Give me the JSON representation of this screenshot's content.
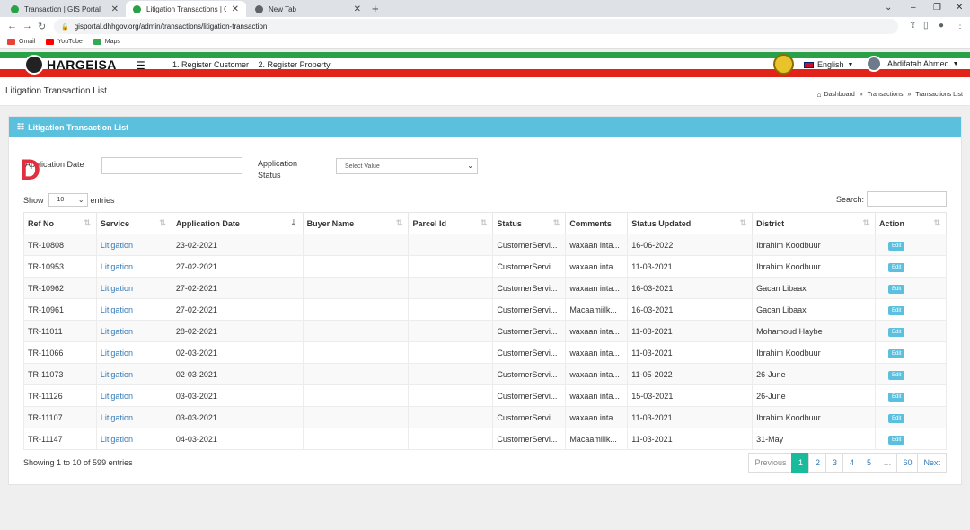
{
  "browser": {
    "tabs": [
      {
        "title": "Transaction | GIS Portal",
        "favicon_color": "#2aa147"
      },
      {
        "title": "Litigation Transactions | GIS Portal",
        "favicon_color": "#2aa147"
      },
      {
        "title": "New Tab",
        "favicon_color": "#5f6368"
      }
    ],
    "url": "gisportal.dhhgov.org/admin/transactions/litigation-transaction",
    "bookmarks": [
      {
        "label": "Gmail",
        "color": "#ea4335"
      },
      {
        "label": "YouTube",
        "color": "#ff0000"
      },
      {
        "label": "Maps",
        "color": "#34a853"
      }
    ]
  },
  "app": {
    "logo_text": "HARGEISA",
    "menu": [
      "1. Register Customer",
      "2. Register Property"
    ],
    "language": "English",
    "user_name": "Abdifatah Ahmed"
  },
  "page": {
    "title": "Litigation Transaction List",
    "breadcrumb": [
      "Dashboard",
      "Transactions",
      "Transactions List"
    ]
  },
  "card": {
    "title": "Litigation Transaction List",
    "filter_date_label": "Application Date",
    "filter_status_label_1": "Application",
    "filter_status_label_2": "Status",
    "filter_status_placeholder": "Select Value",
    "show_label": "Show",
    "page_length": "10",
    "entries_label": "entries",
    "search_label": "Search:",
    "columns": [
      "Ref No",
      "Service",
      "Application Date",
      "Buyer Name",
      "Parcel Id",
      "Status",
      "Comments",
      "Status Updated",
      "District",
      "Action"
    ],
    "rows": [
      {
        "ref": "TR-10808",
        "service": "Litigation",
        "date": "23-02-2021",
        "buyer": "",
        "parcel": "",
        "status": "CustomerServi...",
        "comments": "waxaan inta...",
        "updated": "16-06-2022",
        "district": "Ibrahim Koodbuur",
        "action": "Edit"
      },
      {
        "ref": "TR-10953",
        "service": "Litigation",
        "date": "27-02-2021",
        "buyer": "",
        "parcel": "",
        "status": "CustomerServi...",
        "comments": "waxaan inta...",
        "updated": "11-03-2021",
        "district": "Ibrahim Koodbuur",
        "action": "Edit"
      },
      {
        "ref": "TR-10962",
        "service": "Litigation",
        "date": "27-02-2021",
        "buyer": "",
        "parcel": "",
        "status": "CustomerServi...",
        "comments": "waxaan inta...",
        "updated": "16-03-2021",
        "district": "Gacan Libaax",
        "action": "Edit"
      },
      {
        "ref": "TR-10961",
        "service": "Litigation",
        "date": "27-02-2021",
        "buyer": "",
        "parcel": "",
        "status": "CustomerServi...",
        "comments": "Macaamiilk...",
        "updated": "16-03-2021",
        "district": "Gacan Libaax",
        "action": "Edit"
      },
      {
        "ref": "TR-11011",
        "service": "Litigation",
        "date": "28-02-2021",
        "buyer": "",
        "parcel": "",
        "status": "CustomerServi...",
        "comments": "waxaan inta...",
        "updated": "11-03-2021",
        "district": "Mohamoud Haybe",
        "action": "Edit"
      },
      {
        "ref": "TR-11066",
        "service": "Litigation",
        "date": "02-03-2021",
        "buyer": "",
        "parcel": "",
        "status": "CustomerServi...",
        "comments": "waxaan inta...",
        "updated": "11-03-2021",
        "district": "Ibrahim Koodbuur",
        "action": "Edit"
      },
      {
        "ref": "TR-11073",
        "service": "Litigation",
        "date": "02-03-2021",
        "buyer": "",
        "parcel": "",
        "status": "CustomerServi...",
        "comments": "waxaan inta...",
        "updated": "11-05-2022",
        "district": "26-June",
        "action": "Edit"
      },
      {
        "ref": "TR-11126",
        "service": "Litigation",
        "date": "03-03-2021",
        "buyer": "",
        "parcel": "",
        "status": "CustomerServi...",
        "comments": "waxaan inta...",
        "updated": "15-03-2021",
        "district": "26-June",
        "action": "Edit"
      },
      {
        "ref": "TR-11107",
        "service": "Litigation",
        "date": "03-03-2021",
        "buyer": "",
        "parcel": "",
        "status": "CustomerServi...",
        "comments": "waxaan inta...",
        "updated": "11-03-2021",
        "district": "Ibrahim Koodbuur",
        "action": "Edit"
      },
      {
        "ref": "TR-11147",
        "service": "Litigation",
        "date": "04-03-2021",
        "buyer": "",
        "parcel": "",
        "status": "CustomerServi...",
        "comments": "Macaamiilk...",
        "updated": "11-03-2021",
        "district": "31-May",
        "action": "Edit"
      }
    ],
    "info": "Showing 1 to 10 of 599 entries",
    "pagination": [
      "Previous",
      "1",
      "2",
      "3",
      "4",
      "5",
      "…",
      "60",
      "Next"
    ],
    "current_page": "1"
  },
  "colors": {
    "header_blue": "#5bc0de",
    "page_active": "#18bc9c",
    "stripe_green": "#2aa147",
    "stripe_red": "#e2231a",
    "link": "#337ab7"
  }
}
